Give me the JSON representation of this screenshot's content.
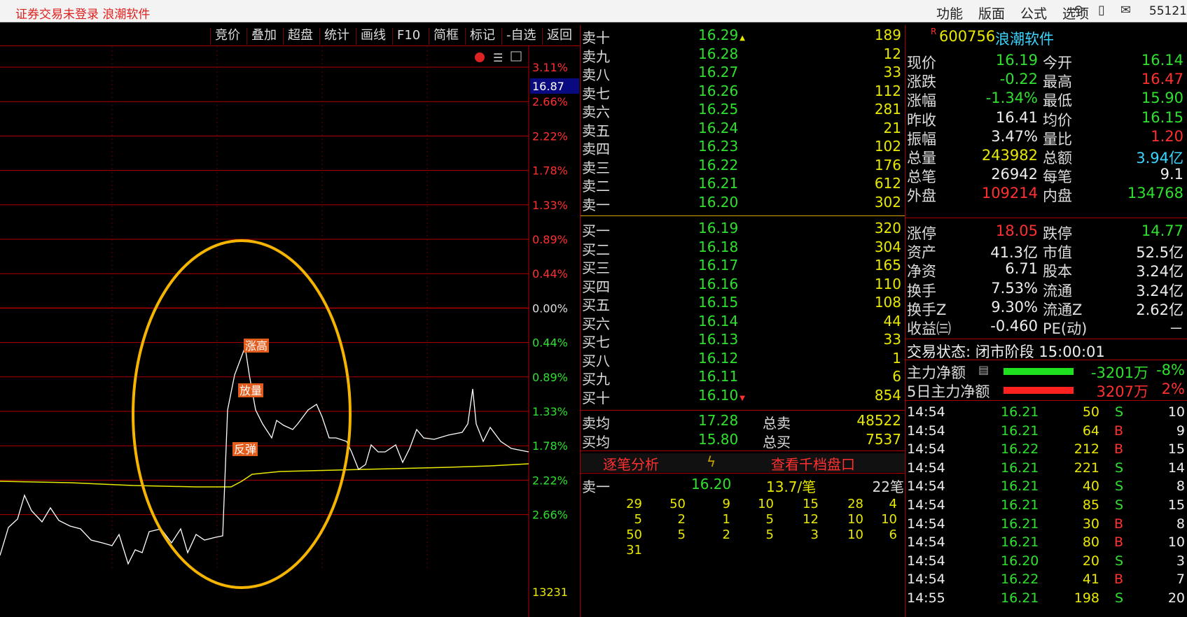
{
  "app": {
    "title": "证券交易未登录   浪潮软件",
    "menu": [
      "功能",
      "版面",
      "公式",
      "选项"
    ],
    "corner_num": "55121"
  },
  "toolbar": {
    "buttons": [
      "竞价",
      "叠加",
      "超盘",
      "统计",
      "画线",
      "F10",
      "简框",
      "标记",
      "-自选",
      "返回"
    ]
  },
  "chart": {
    "price_label": "16.87",
    "pct_labels": [
      "3.11%",
      "2.66%",
      "2.22%",
      "1.78%",
      "1.33%",
      "0.89%",
      "0.44%",
      "0.00%",
      "0.44%",
      "0.89%",
      "1.33%",
      "1.78%",
      "2.22%",
      "2.66%"
    ],
    "volume_label": "13231",
    "annotations": [
      "涨高",
      "放量",
      "反弹"
    ],
    "colors": {
      "price_line": "#ffffff",
      "avg_line": "#e8e800",
      "grid": "#b00000",
      "circle": "#f5b400"
    }
  },
  "book": {
    "asks": [
      {
        "label": "卖十",
        "price": "16.29",
        "vol": "189"
      },
      {
        "label": "卖九",
        "price": "16.28",
        "vol": "12"
      },
      {
        "label": "卖八",
        "price": "16.27",
        "vol": "33"
      },
      {
        "label": "卖七",
        "price": "16.26",
        "vol": "112"
      },
      {
        "label": "卖六",
        "price": "16.25",
        "vol": "281"
      },
      {
        "label": "卖五",
        "price": "16.24",
        "vol": "21"
      },
      {
        "label": "卖四",
        "price": "16.23",
        "vol": "102"
      },
      {
        "label": "卖三",
        "price": "16.22",
        "vol": "176"
      },
      {
        "label": "卖二",
        "price": "16.21",
        "vol": "612"
      },
      {
        "label": "卖一",
        "price": "16.20",
        "vol": "302"
      }
    ],
    "bids": [
      {
        "label": "买一",
        "price": "16.19",
        "vol": "320"
      },
      {
        "label": "买二",
        "price": "16.18",
        "vol": "304"
      },
      {
        "label": "买三",
        "price": "16.17",
        "vol": "165"
      },
      {
        "label": "买四",
        "price": "16.16",
        "vol": "110"
      },
      {
        "label": "买五",
        "price": "16.15",
        "vol": "108"
      },
      {
        "label": "买六",
        "price": "16.14",
        "vol": "44"
      },
      {
        "label": "买七",
        "price": "16.13",
        "vol": "33"
      },
      {
        "label": "买八",
        "price": "16.12",
        "vol": "1"
      },
      {
        "label": "买九",
        "price": "16.11",
        "vol": "6"
      },
      {
        "label": "买十",
        "price": "16.10",
        "vol": "854"
      }
    ],
    "avg_ask": {
      "label": "卖均",
      "price": "17.28",
      "tlabel": "总卖",
      "vol": "48522"
    },
    "avg_bid": {
      "label": "买均",
      "price": "15.80",
      "tlabel": "总买",
      "vol": "7537"
    },
    "links": {
      "tick_analysis": "逐笔分析",
      "thousand": "查看千档盘口"
    },
    "queue_head": {
      "label": "卖一",
      "price": "16.20",
      "avg": "13.7/笔",
      "count": "22笔"
    },
    "queue": [
      [
        "29",
        "50",
        "9",
        "10",
        "15",
        "28",
        "4"
      ],
      [
        "5",
        "2",
        "1",
        "5",
        "12",
        "10",
        "10"
      ],
      [
        "50",
        "5",
        "2",
        "5",
        "3",
        "10",
        "6"
      ],
      [
        "31"
      ]
    ]
  },
  "info": {
    "code_tag": "R",
    "code": "600756",
    "name": "浪潮软件",
    "rows": [
      {
        "l1": "现价",
        "v1": "16.19",
        "c1": "green",
        "l2": "今开",
        "v2": "16.14",
        "c2": "green"
      },
      {
        "l1": "涨跌",
        "v1": "-0.22",
        "c1": "green",
        "l2": "最高",
        "v2": "16.47",
        "c2": "red"
      },
      {
        "l1": "涨幅",
        "v1": "-1.34%",
        "c1": "green",
        "l2": "最低",
        "v2": "15.90",
        "c2": "green"
      },
      {
        "l1": "昨收",
        "v1": "16.41",
        "c1": "white",
        "l2": "均价",
        "v2": "16.15",
        "c2": "green"
      },
      {
        "l1": "振幅",
        "v1": "3.47%",
        "c1": "white",
        "l2": "量比",
        "v2": "1.20",
        "c2": "red"
      },
      {
        "l1": "总量",
        "v1": "243982",
        "c1": "yellow",
        "l2": "总额",
        "v2": "3.94亿",
        "c2": "cyan"
      },
      {
        "l1": "总笔",
        "v1": "26942",
        "c1": "white",
        "l2": "每笔",
        "v2": "9.1",
        "c2": "white"
      },
      {
        "l1": "外盘",
        "v1": "109214",
        "c1": "red",
        "l2": "内盘",
        "v2": "134768",
        "c2": "green"
      }
    ],
    "rows2": [
      {
        "l1": "涨停",
        "v1": "18.05",
        "c1": "red",
        "l2": "跌停",
        "v2": "14.77",
        "c2": "green"
      },
      {
        "l1": "资产",
        "v1": "41.3亿",
        "c1": "white",
        "l2": "市值",
        "v2": "52.5亿",
        "c2": "white"
      },
      {
        "l1": "净资",
        "v1": "6.71",
        "c1": "white",
        "l2": "股本",
        "v2": "3.24亿",
        "c2": "white"
      },
      {
        "l1": "换手",
        "v1": "7.53%",
        "c1": "white",
        "l2": "流通",
        "v2": "3.24亿",
        "c2": "white"
      },
      {
        "l1": "换手Z",
        "v1": "9.30%",
        "c1": "white",
        "l2": "流通Z",
        "v2": "2.62亿",
        "c2": "white"
      },
      {
        "l1": "收益㈢",
        "v1": "-0.460",
        "c1": "white",
        "l2": "PE(动)",
        "v2": "－",
        "c2": "white"
      }
    ],
    "status": "交易状态: 闭市阶段 15:00:01",
    "main_flow": {
      "label": "主力净额",
      "value": "-3201万",
      "pct": "-8%"
    },
    "main_flow5": {
      "label": "5日主力净额",
      "value": "3207万",
      "pct": "2%"
    },
    "ticks": [
      {
        "t": "14:54",
        "p": "16.21",
        "v": "50",
        "d": "S",
        "n": "10"
      },
      {
        "t": "14:54",
        "p": "16.21",
        "v": "64",
        "d": "B",
        "n": "9"
      },
      {
        "t": "14:54",
        "p": "16.22",
        "v": "212",
        "d": "B",
        "n": "15"
      },
      {
        "t": "14:54",
        "p": "16.21",
        "v": "221",
        "d": "S",
        "n": "14"
      },
      {
        "t": "14:54",
        "p": "16.21",
        "v": "40",
        "d": "S",
        "n": "8"
      },
      {
        "t": "14:54",
        "p": "16.21",
        "v": "85",
        "d": "S",
        "n": "15"
      },
      {
        "t": "14:54",
        "p": "16.21",
        "v": "30",
        "d": "B",
        "n": "8"
      },
      {
        "t": "14:54",
        "p": "16.21",
        "v": "80",
        "d": "B",
        "n": "10"
      },
      {
        "t": "14:54",
        "p": "16.20",
        "v": "20",
        "d": "S",
        "n": "3"
      },
      {
        "t": "14:54",
        "p": "16.22",
        "v": "41",
        "d": "B",
        "n": "7"
      },
      {
        "t": "14:55",
        "p": "16.21",
        "v": "198",
        "d": "S",
        "n": "20"
      }
    ]
  }
}
